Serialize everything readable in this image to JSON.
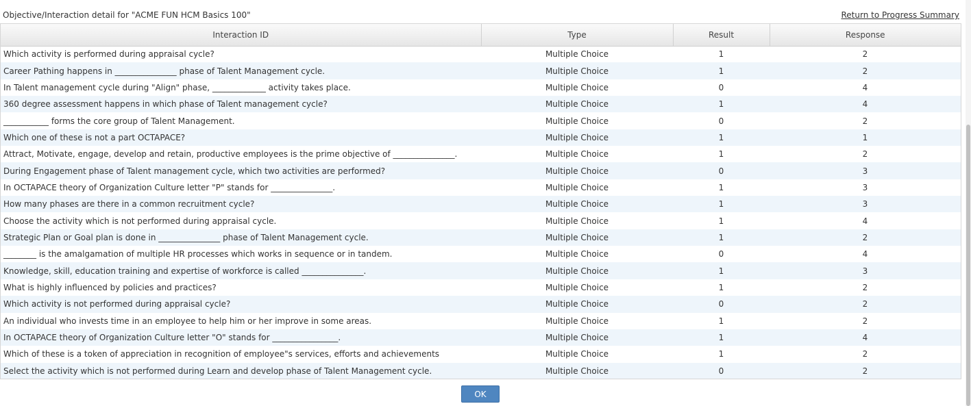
{
  "header": {
    "title": "Objective/Interaction detail for \"ACME FUN HCM Basics 100\"",
    "return_link": "Return to Progress Summary"
  },
  "table": {
    "columns": [
      "Interaction ID",
      "Type",
      "Result",
      "Response"
    ],
    "rows": [
      {
        "id": "Which activity is performed during appraisal cycle?",
        "type": "Multiple Choice",
        "result": "1",
        "response": "2"
      },
      {
        "id": "Career Pathing happens in _______________ phase of Talent Management cycle.",
        "type": "Multiple Choice",
        "result": "1",
        "response": "2"
      },
      {
        "id": "In Talent management cycle during \"Align\" phase, _____________ activity takes place.",
        "type": "Multiple Choice",
        "result": "0",
        "response": "4"
      },
      {
        "id": "360 degree assessment happens in which phase of Talent management cycle?",
        "type": "Multiple Choice",
        "result": "1",
        "response": "4"
      },
      {
        "id": "___________ forms the core group of Talent Management.",
        "type": "Multiple Choice",
        "result": "0",
        "response": "2"
      },
      {
        "id": "Which one of these is not a part OCTAPACE?",
        "type": "Multiple Choice",
        "result": "1",
        "response": "1"
      },
      {
        "id": "Attract, Motivate, engage, develop and retain, productive employees is the prime objective of _______________.",
        "type": "Multiple Choice",
        "result": "1",
        "response": "2"
      },
      {
        "id": "During Engagement phase of Talent management cycle, which two activities are performed?",
        "type": "Multiple Choice",
        "result": "0",
        "response": "3"
      },
      {
        "id": "In OCTAPACE theory of Organization Culture letter \"P\" stands for _______________.",
        "type": "Multiple Choice",
        "result": "1",
        "response": "3"
      },
      {
        "id": "How many phases are there in a common recruitment cycle?",
        "type": "Multiple Choice",
        "result": "1",
        "response": "3"
      },
      {
        "id": "Choose the activity which is not performed during appraisal cycle.",
        "type": "Multiple Choice",
        "result": "1",
        "response": "4"
      },
      {
        "id": "Strategic Plan or Goal plan is done in _______________ phase of Talent Management cycle.",
        "type": "Multiple Choice",
        "result": "1",
        "response": "2"
      },
      {
        "id": "________ is the amalgamation of multiple HR processes which works in sequence or in tandem.",
        "type": "Multiple Choice",
        "result": "0",
        "response": "4"
      },
      {
        "id": "Knowledge, skill, education training and expertise of workforce is called _______________.",
        "type": "Multiple Choice",
        "result": "1",
        "response": "3"
      },
      {
        "id": "What is highly influenced by policies and practices?",
        "type": "Multiple Choice",
        "result": "1",
        "response": "2"
      },
      {
        "id": "Which activity is not performed during appraisal cycle?",
        "type": "Multiple Choice",
        "result": "0",
        "response": "2"
      },
      {
        "id": "An individual who invests time in an employee to help him or her improve in some areas.",
        "type": "Multiple Choice",
        "result": "1",
        "response": "2"
      },
      {
        "id": "In OCTAPACE theory of Organization Culture letter \"O\" stands for ________________.",
        "type": "Multiple Choice",
        "result": "1",
        "response": "4"
      },
      {
        "id": "Which of these is a token of appreciation in recognition of employee\"s services, efforts and achievements",
        "type": "Multiple Choice",
        "result": "1",
        "response": "2"
      },
      {
        "id": "Select the activity which is not performed during Learn and develop phase of Talent Management cycle.",
        "type": "Multiple Choice",
        "result": "0",
        "response": "2"
      }
    ]
  },
  "buttons": {
    "ok_label": "OK"
  },
  "colors": {
    "stripe": "#eef5fb",
    "button": "#4f86c0"
  }
}
